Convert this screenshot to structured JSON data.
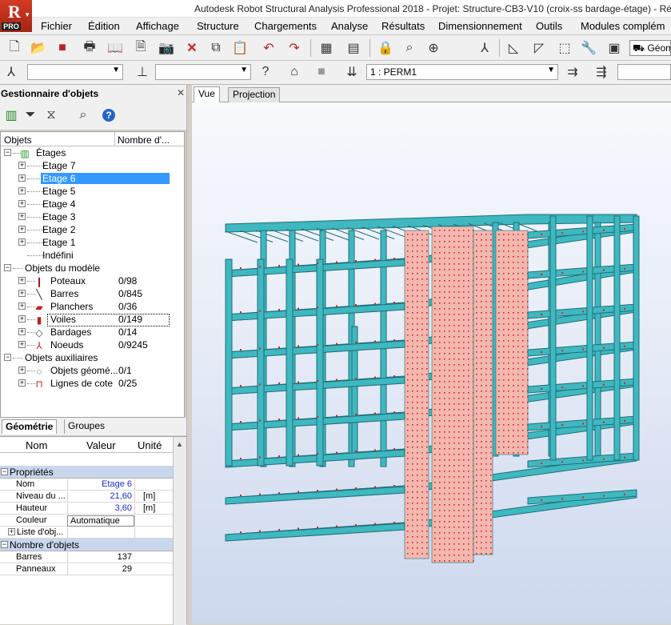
{
  "app": {
    "title": "Autodesk Robot Structural Analysis Professional 2018 - Projet: Structure-CB3-V10 (croix-ss bardage-étage) - Résul",
    "logo_letter": "R",
    "logo_badge": "PRO"
  },
  "menu": [
    "Fichier",
    "Édition",
    "Affichage",
    "Structure",
    "Chargements",
    "Analyse",
    "Résultats",
    "Dimensionnement",
    "Outils",
    "Modules complém"
  ],
  "toolbar": {
    "geometry_button": "Géom",
    "load_case": "1 : PERM1"
  },
  "object_manager": {
    "title": "Gestionnaire d'objets",
    "col_objects": "Objets",
    "col_count": "Nombre d'...",
    "tree": [
      {
        "label": "Étages",
        "level": 0,
        "expand": "−"
      },
      {
        "label": "Etage 7",
        "level": 1,
        "expand": "+"
      },
      {
        "label": "Etage 6",
        "level": 1,
        "expand": "+",
        "selected": true
      },
      {
        "label": "Etage 5",
        "level": 1,
        "expand": "+"
      },
      {
        "label": "Etage 4",
        "level": 1,
        "expand": "+"
      },
      {
        "label": "Etage 3",
        "level": 1,
        "expand": "+"
      },
      {
        "label": "Etage 2",
        "level": 1,
        "expand": "+"
      },
      {
        "label": "Etage 1",
        "level": 1,
        "expand": "+"
      },
      {
        "label": "Indéfini",
        "level": 1,
        "expand": ""
      },
      {
        "label": "Objets du modèle",
        "level": 0,
        "expand": "−"
      },
      {
        "label": "Poteaux",
        "level": 1,
        "expand": "+",
        "count": "0/98"
      },
      {
        "label": "Barres",
        "level": 1,
        "expand": "+",
        "count": "0/845"
      },
      {
        "label": "Planchers",
        "level": 1,
        "expand": "+",
        "count": "0/36"
      },
      {
        "label": "Voiles",
        "level": 1,
        "expand": "+",
        "count": "0/149",
        "focused": true
      },
      {
        "label": "Bardages",
        "level": 1,
        "expand": "+",
        "count": "0/14"
      },
      {
        "label": "Noeuds",
        "level": 1,
        "expand": "+",
        "count": "0/9245"
      },
      {
        "label": "Objets auxiliaires",
        "level": 0,
        "expand": "−"
      },
      {
        "label": "Objets géomé...",
        "level": 1,
        "expand": "+",
        "count": "0/1"
      },
      {
        "label": "Lignes de cote",
        "level": 1,
        "expand": "+",
        "count": "0/25"
      }
    ]
  },
  "bottom_tabs": [
    "Géométrie",
    "Groupes"
  ],
  "properties": {
    "col_name": "Nom",
    "col_value": "Valeur",
    "col_unit": "Unité",
    "category1": "Propriétés",
    "rows1": [
      {
        "name": "Nom",
        "value": "Etage 6",
        "unit": ""
      },
      {
        "name": "Niveau du ...",
        "value": "21,60",
        "unit": "[m]"
      },
      {
        "name": "Hauteur",
        "value": "3,60",
        "unit": "[m]"
      },
      {
        "name": "Couleur",
        "value": "Automatique",
        "unit": ""
      },
      {
        "name": "Liste d'obj...",
        "value": "",
        "unit": ""
      }
    ],
    "category2": "Nombre d'objets",
    "rows2": [
      {
        "name": "Barres",
        "value": "137"
      },
      {
        "name": "Panneaux",
        "value": "29"
      }
    ]
  },
  "view_tabs": [
    "Vue",
    "Projection"
  ],
  "colors": {
    "structure": "#3fb8c0",
    "structure_dark": "#1d6f78",
    "shear_wall": "#f2b8b0",
    "nodes": "#e02020",
    "selection": "#3399ff"
  }
}
